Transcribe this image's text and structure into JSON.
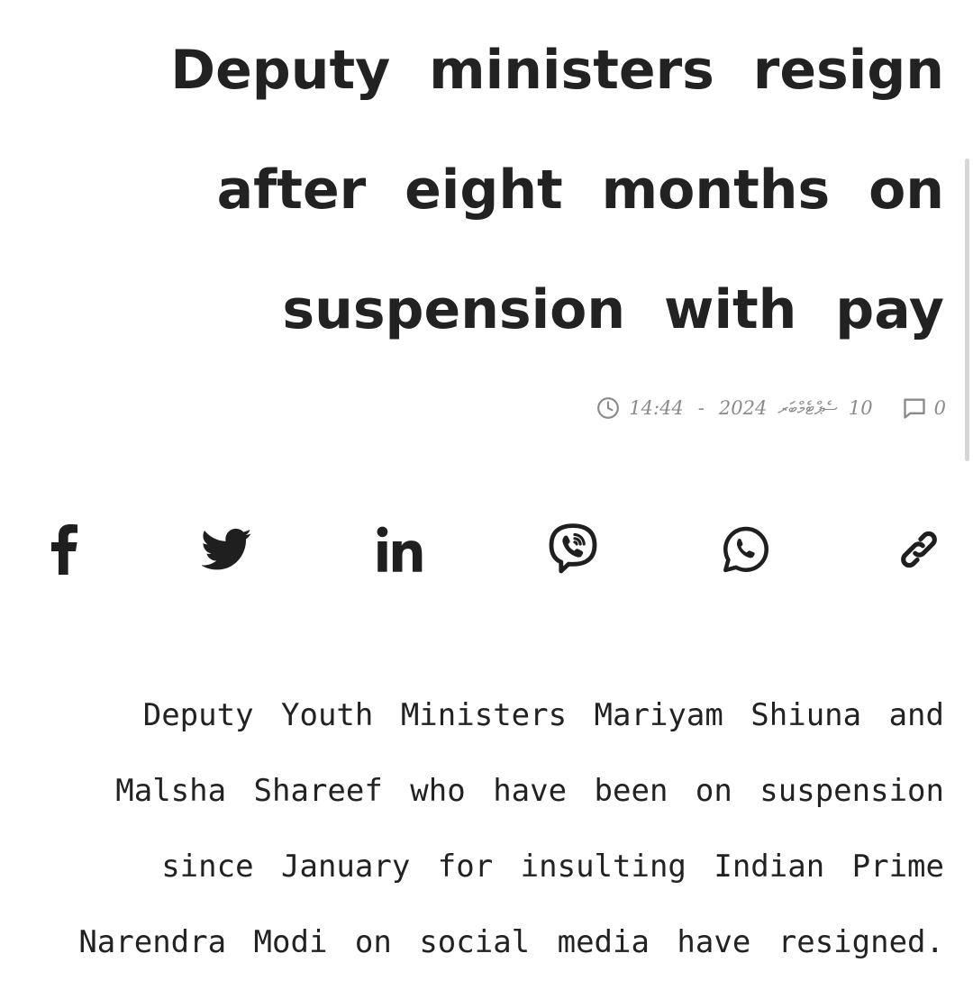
{
  "article": {
    "title": "Deputy ministers resign after eight months on suspension with pay",
    "meta": {
      "time": "14:44",
      "separator": "-",
      "year": "2024",
      "month": "ސެޕްޓެމްބަރ",
      "day": "10",
      "comment_count": "0"
    },
    "body": "Deputy Youth Ministers Mariyam Shiuna and Malsha Shareef who have been on suspension since January for insulting Indian Prime Narendra Modi on social media have resigned."
  },
  "share": {
    "buttons": [
      {
        "name": "facebook",
        "icon": "facebook-icon"
      },
      {
        "name": "twitter",
        "icon": "twitter-icon"
      },
      {
        "name": "linkedin",
        "icon": "linkedin-icon"
      },
      {
        "name": "viber",
        "icon": "viber-icon"
      },
      {
        "name": "whatsapp",
        "icon": "whatsapp-icon"
      },
      {
        "name": "copy-link",
        "icon": "link-icon"
      }
    ]
  },
  "colors": {
    "text": "#222222",
    "meta_text": "#8a8a8a",
    "icon": "#1f1f1f",
    "background": "#ffffff",
    "scrollbar": "#d6d6d6"
  }
}
